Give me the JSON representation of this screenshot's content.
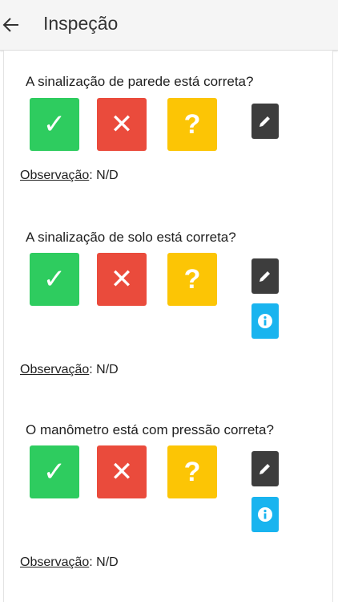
{
  "header": {
    "title": "Inspeção",
    "back_icon": "arrow-left-icon"
  },
  "questions": [
    {
      "text": "A sinalização de parede está correta?",
      "observation_label": "Observação",
      "observation_value": "N/D",
      "has_info": false
    },
    {
      "text": "A sinalização de solo está correta?",
      "observation_label": "Observação",
      "observation_value": "N/D",
      "has_info": true
    },
    {
      "text": "O manômetro está com pressão correta?",
      "observation_label": "Observação",
      "observation_value": "N/D",
      "has_info": true
    }
  ],
  "answer_buttons": {
    "yes_glyph": "✓",
    "no_glyph": "✕",
    "unknown_glyph": "?"
  },
  "colors": {
    "yes": "#2ecc5f",
    "no": "#ea4b3c",
    "unknown": "#fcc505",
    "edit": "#3d3d3d",
    "info": "#19b4ef"
  }
}
